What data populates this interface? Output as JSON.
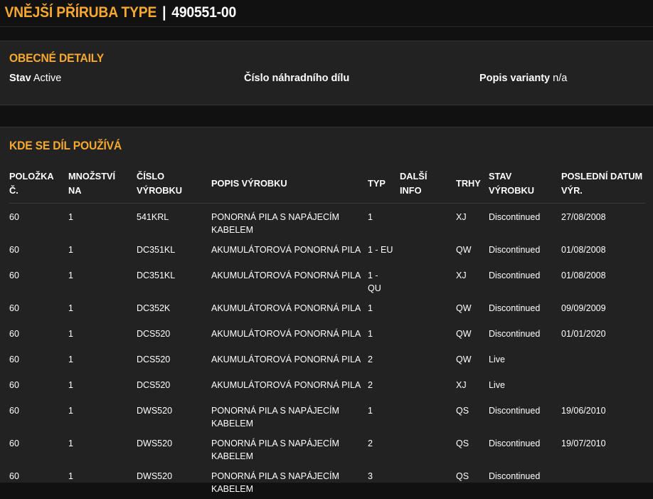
{
  "header": {
    "title": "VNĚJŠÍ PŘÍRUBA TYPE",
    "separator": "|",
    "part_number": "490551-00"
  },
  "general": {
    "heading": "OBECNÉ DETAILY",
    "status_label": "Stav",
    "status_value": "Active",
    "spare_part_label": "Číslo náhradního dílu",
    "spare_part_value": "",
    "variant_label": "Popis varianty",
    "variant_value": "n/a"
  },
  "usage": {
    "heading": "KDE SE DÍL POUŽÍVÁ",
    "columns": [
      [
        "POLOŽKA",
        "Č."
      ],
      [
        "MNOŽSTVÍ",
        "NA"
      ],
      [
        "ČÍSLO",
        "VÝROBKU"
      ],
      [
        "POPIS VÝROBKU",
        ""
      ],
      [
        "TYP",
        ""
      ],
      [
        "DALŠÍ",
        "INFO"
      ],
      [
        "TRHY",
        ""
      ],
      [
        "STAV",
        "VÝROBKU"
      ],
      [
        "POSLEDNÍ DATUM",
        "VÝR."
      ]
    ],
    "rows": [
      {
        "item": "60",
        "qty": "1",
        "product": "541KRL",
        "desc1": "PONORNÁ PILA S NAPÁJECÍM",
        "desc2": "KABELEM",
        "type1": "1",
        "type2": "",
        "info": "",
        "market": "XJ",
        "status": "Discontinued",
        "date": "27/08/2008"
      },
      {
        "item": "60",
        "qty": "1",
        "product": "DC351KL",
        "desc1": "AKUMULÁTOROVÁ PONORNÁ PILA",
        "desc2": "",
        "type1": "1 - EU",
        "type2": "",
        "info": "",
        "market": "QW",
        "status": "Discontinued",
        "date": "01/08/2008"
      },
      {
        "item": "60",
        "qty": "1",
        "product": "DC351KL",
        "desc1": "AKUMULÁTOROVÁ PONORNÁ PILA",
        "desc2": "",
        "type1": "1 -",
        "type2": "QU",
        "info": "",
        "market": "XJ",
        "status": "Discontinued",
        "date": "01/08/2008"
      },
      {
        "item": "60",
        "qty": "1",
        "product": "DC352K",
        "desc1": "AKUMULÁTOROVÁ PONORNÁ PILA",
        "desc2": "",
        "type1": "1",
        "type2": "",
        "info": "",
        "market": "QW",
        "status": "Discontinued",
        "date": "09/09/2009"
      },
      {
        "item": "60",
        "qty": "1",
        "product": "DCS520",
        "desc1": "AKUMULÁTOROVÁ PONORNÁ PILA",
        "desc2": "",
        "type1": "1",
        "type2": "",
        "info": "",
        "market": "QW",
        "status": "Discontinued",
        "date": "01/01/2020"
      },
      {
        "item": "60",
        "qty": "1",
        "product": "DCS520",
        "desc1": "AKUMULÁTOROVÁ PONORNÁ PILA",
        "desc2": "",
        "type1": "2",
        "type2": "",
        "info": "",
        "market": "QW",
        "status": "Live",
        "date": ""
      },
      {
        "item": "60",
        "qty": "1",
        "product": "DCS520",
        "desc1": "AKUMULÁTOROVÁ PONORNÁ PILA",
        "desc2": "",
        "type1": "2",
        "type2": "",
        "info": "",
        "market": "XJ",
        "status": "Live",
        "date": ""
      },
      {
        "item": "60",
        "qty": "1",
        "product": "DWS520",
        "desc1": "PONORNÁ PILA S NAPÁJECÍM",
        "desc2": "KABELEM",
        "type1": "1",
        "type2": "",
        "info": "",
        "market": "QS",
        "status": "Discontinued",
        "date": "19/06/2010"
      },
      {
        "item": "60",
        "qty": "1",
        "product": "DWS520",
        "desc1": "PONORNÁ PILA S NAPÁJECÍM",
        "desc2": "KABELEM",
        "type1": "2",
        "type2": "",
        "info": "",
        "market": "QS",
        "status": "Discontinued",
        "date": "19/07/2010"
      },
      {
        "item": "60",
        "qty": "1",
        "product": "DWS520",
        "desc1": "PONORNÁ PILA S NAPÁJECÍM",
        "desc2": "KABELEM",
        "type1": "3",
        "type2": "",
        "info": "",
        "market": "QS",
        "status": "Discontinued",
        "date": ""
      }
    ]
  },
  "colors": {
    "accent": "#f6a830",
    "background": "#111111",
    "panel": "#222222",
    "text": "#ffffff"
  }
}
